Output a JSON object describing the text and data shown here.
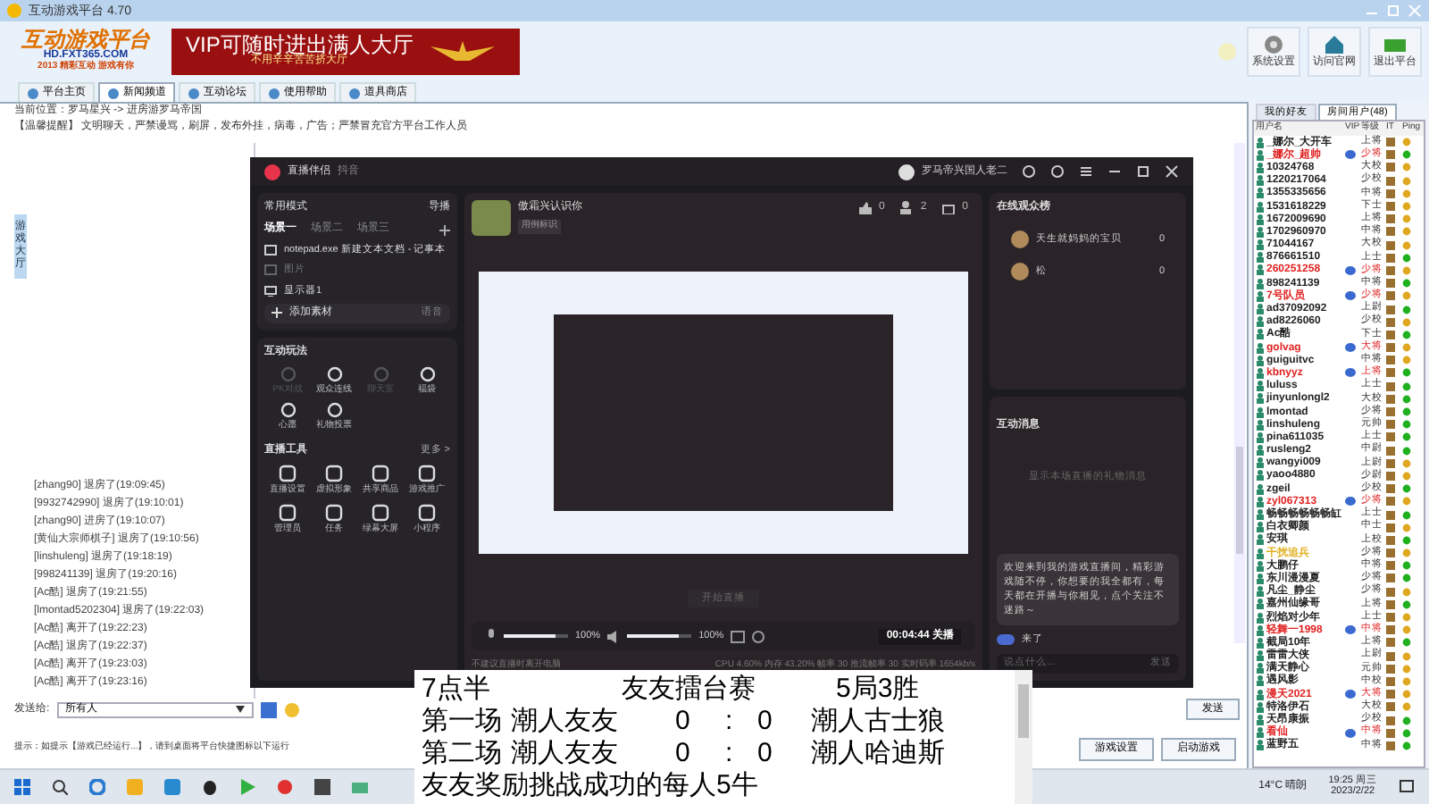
{
  "window": {
    "title": "互动游戏平台 4.70"
  },
  "header": {
    "logo_text": "互动游戏平台",
    "logo_url": "HD.FXT365.COM",
    "logo_slogan": "2013 精彩互动 游戏有你",
    "banner_title": "VIP可随时进出满人大厅",
    "banner_subtitle": "不用辛辛苦苦挤大厅",
    "buttons": [
      {
        "label": "系统设置",
        "kind": "gear"
      },
      {
        "label": "访问官网",
        "kind": "house"
      },
      {
        "label": "退出平台",
        "kind": "exit"
      }
    ]
  },
  "nav_tabs": [
    {
      "label": "平台主页",
      "selected": false
    },
    {
      "label": "新闻频道",
      "selected": true
    },
    {
      "label": "互动论坛",
      "selected": false
    },
    {
      "label": "使用帮助",
      "selected": false
    },
    {
      "label": "道具商店",
      "selected": false
    }
  ],
  "location": "当前位置：罗马星兴 -> 进房游罗马帝国",
  "notice": "【温馨提醒】 文明聊天，严禁谩骂，刷屏，发布外挂，病毒，广告；严禁冒充官方平台工作人员",
  "side_tab": "游戏大厅",
  "chat_log": [
    "[zhang90] 退房了(19:09:45)",
    "[9932742990] 退房了(19:10:01)",
    "[zhang90] 进房了(19:10:07)",
    "[黄仙大宗师棋子] 退房了(19:10:56)",
    "[linshuleng] 退房了(19:18:19)",
    "[998241139] 退房了(19:20:16)",
    "[Ac酷] 退房了(19:21:55)",
    "[lmontad5202304] 退房了(19:22:03)",
    "[Ac酷] 离开了(19:22:23)",
    "[Ac酷] 退房了(19:22:37)",
    "[Ac酷] 离开了(19:23:03)",
    "[Ac酷] 离开了(19:23:16)"
  ],
  "send_to_label": "发送给:",
  "send_to_value": "所有人",
  "send_button": "发送",
  "tip": "提示：如提示【游戏已经运行...】，请到桌面将平台快捷图标以下运行",
  "bottom_buttons": [
    "游戏设置",
    "启动游戏"
  ],
  "user_panel": {
    "tabs": [
      {
        "label": "我的好友",
        "selected": false
      },
      {
        "label": "房间用户(48)",
        "selected": true
      }
    ],
    "columns": [
      "用户名",
      "VIP",
      "等级",
      "IT",
      "Ping"
    ],
    "users": [
      {
        "name": "_娜尔_大开车",
        "level": "上将",
        "color": "#222222",
        "vip": false,
        "ping_good": false
      },
      {
        "name": "_娜尔_超帅",
        "level": "少将",
        "color": "#e02020",
        "vip": true,
        "ping_good": true
      },
      {
        "name": "10324768",
        "level": "大校",
        "color": "#222222",
        "vip": false,
        "ping_good": false
      },
      {
        "name": "1220217064",
        "level": "少校",
        "color": "#222222",
        "vip": false,
        "ping_good": false
      },
      {
        "name": "1355335656",
        "level": "中将",
        "color": "#222222",
        "vip": false,
        "ping_good": false
      },
      {
        "name": "1531618229",
        "level": "下士",
        "color": "#222222",
        "vip": false,
        "ping_good": false
      },
      {
        "name": "1672009690",
        "level": "上将",
        "color": "#222222",
        "vip": false,
        "ping_good": false
      },
      {
        "name": "1702960970",
        "level": "中将",
        "color": "#222222",
        "vip": false,
        "ping_good": false
      },
      {
        "name": "71044167",
        "level": "大校",
        "color": "#222222",
        "vip": false,
        "ping_good": false
      },
      {
        "name": "876661510",
        "level": "上士",
        "color": "#222222",
        "vip": false,
        "ping_good": true
      },
      {
        "name": "260251258",
        "level": "少将",
        "color": "#e02020",
        "vip": true,
        "ping_good": false
      },
      {
        "name": "898241139",
        "level": "中将",
        "color": "#222222",
        "vip": false,
        "ping_good": true
      },
      {
        "name": "7号队员",
        "level": "少将",
        "color": "#e02020",
        "vip": true,
        "ping_good": false
      },
      {
        "name": "ad37092092",
        "level": "上尉",
        "color": "#222222",
        "vip": false,
        "ping_good": true
      },
      {
        "name": "ad8226060",
        "level": "少校",
        "color": "#222222",
        "vip": false,
        "ping_good": false
      },
      {
        "name": "Ac酷",
        "level": "下士",
        "color": "#222222",
        "vip": false,
        "ping_good": true
      },
      {
        "name": "golvag",
        "level": "大将",
        "color": "#e02020",
        "vip": true,
        "ping_good": false
      },
      {
        "name": "guiguitvc",
        "level": "中将",
        "color": "#222222",
        "vip": false,
        "ping_good": false
      },
      {
        "name": "kbnyyz",
        "level": "上将",
        "color": "#e02020",
        "vip": true,
        "ping_good": true
      },
      {
        "name": "luluss",
        "level": "上士",
        "color": "#222222",
        "vip": false,
        "ping_good": true
      },
      {
        "name": "jinyunlongl2",
        "level": "大校",
        "color": "#222222",
        "vip": false,
        "ping_good": true
      },
      {
        "name": "lmontad",
        "level": "少将",
        "color": "#222222",
        "vip": false,
        "ping_good": true
      },
      {
        "name": "linshuleng",
        "level": "元帅",
        "color": "#222222",
        "vip": false,
        "ping_good": true
      },
      {
        "name": "pina611035",
        "level": "上士",
        "color": "#222222",
        "vip": false,
        "ping_good": true
      },
      {
        "name": "rusleng2",
        "level": "中尉",
        "color": "#222222",
        "vip": false,
        "ping_good": true
      },
      {
        "name": "wangyi009",
        "level": "上尉",
        "color": "#222222",
        "vip": false,
        "ping_good": false
      },
      {
        "name": "yaoo4880",
        "level": "少尉",
        "color": "#222222",
        "vip": false,
        "ping_good": false
      },
      {
        "name": "zgeil",
        "level": "少校",
        "color": "#222222",
        "vip": false,
        "ping_good": true
      },
      {
        "name": "zyl067313",
        "level": "少将",
        "color": "#e02020",
        "vip": true,
        "ping_good": false
      },
      {
        "name": "畅畅畅畅畅畅缸",
        "level": "上士",
        "color": "#222222",
        "vip": false,
        "ping_good": true
      },
      {
        "name": "白衣卿颜",
        "level": "中士",
        "color": "#222222",
        "vip": false,
        "ping_good": false
      },
      {
        "name": "安琪",
        "level": "上校",
        "color": "#222222",
        "vip": false,
        "ping_good": true
      },
      {
        "name": "干扰追兵",
        "level": "少将",
        "color": "#e0b020",
        "vip": false,
        "ping_good": false
      },
      {
        "name": "大鹏仔",
        "level": "中将",
        "color": "#222222",
        "vip": false,
        "ping_good": true
      },
      {
        "name": "东川漫漫夏",
        "level": "少将",
        "color": "#222222",
        "vip": false,
        "ping_good": true
      },
      {
        "name": "凡尘_静尘",
        "level": "少将",
        "color": "#222222",
        "vip": false,
        "ping_good": false
      },
      {
        "name": "嘉州仙缘哥",
        "level": "上将",
        "color": "#222222",
        "vip": false,
        "ping_good": true
      },
      {
        "name": "烈焰对少年",
        "level": "上士",
        "color": "#222222",
        "vip": false,
        "ping_good": false
      },
      {
        "name": "轻舞一1998",
        "level": "中将",
        "color": "#e02020",
        "vip": true,
        "ping_good": false
      },
      {
        "name": "截局10年",
        "level": "上将",
        "color": "#222222",
        "vip": false,
        "ping_good": true
      },
      {
        "name": "雷雷大侠",
        "level": "上尉",
        "color": "#222222",
        "vip": false,
        "ping_good": false
      },
      {
        "name": "满天静心",
        "level": "元帅",
        "color": "#222222",
        "vip": false,
        "ping_good": false
      },
      {
        "name": "遇风影",
        "level": "中校",
        "color": "#222222",
        "vip": false,
        "ping_good": false
      },
      {
        "name": "漫天2021",
        "level": "大将",
        "color": "#e02020",
        "vip": true,
        "ping_good": false
      },
      {
        "name": "特洛伊石",
        "level": "大校",
        "color": "#222222",
        "vip": false,
        "ping_good": false
      },
      {
        "name": "天昂康振",
        "level": "少校",
        "color": "#222222",
        "vip": false,
        "ping_good": true
      },
      {
        "name": "看仙",
        "level": "中将",
        "color": "#e02020",
        "vip": true,
        "ping_good": true
      },
      {
        "name": "蓝野五",
        "level": "中将",
        "color": "#222222",
        "vip": false,
        "ping_good": true
      }
    ]
  },
  "stream_app": {
    "title": "直播伴侣",
    "platform": "抖音",
    "account": "罗马帝兴国人老二",
    "mode": "常用模式",
    "director": "导播",
    "scenes": [
      {
        "label": "场景一",
        "selected": true
      },
      {
        "label": "场景二",
        "selected": false
      },
      {
        "label": "场景三",
        "selected": false
      }
    ],
    "sources": [
      {
        "label": "notepad.exe 新建文本文档 - 记事本",
        "kind": "window"
      },
      {
        "label": "图片",
        "kind": "image"
      },
      {
        "label": "显示器1",
        "kind": "monitor"
      }
    ],
    "add_source": "添加素材",
    "add_source_hint": "语音",
    "interact_title": "互动玩法",
    "interact_items": [
      {
        "label": "PK对战",
        "disabled": true
      },
      {
        "label": "观众连线",
        "disabled": false
      },
      {
        "label": "聊天室",
        "disabled": true
      },
      {
        "label": "福袋",
        "disabled": false
      },
      {
        "label": "心愿",
        "disabled": false
      },
      {
        "label": "礼物投票",
        "disabled": false
      }
    ],
    "tools_title": "直播工具",
    "tools_more": "更多 >",
    "tools": [
      "直播设置",
      "虚拟形象",
      "共享商品",
      "游戏推广",
      "管理员",
      "任务",
      "绿幕大屏",
      "小程序"
    ],
    "room_name": "傲霜兴认识你",
    "room_tag": "用例标识",
    "stats": [
      {
        "kind": "like",
        "value": "0"
      },
      {
        "kind": "viewer",
        "value": "2"
      },
      {
        "kind": "gift",
        "value": "0"
      }
    ],
    "mic_volume": {
      "level": 0.8,
      "reading": "100%"
    },
    "speaker_volume": {
      "level": 0.8,
      "reading": "100%"
    },
    "timer": "00:04:44 关播",
    "start_hint": "开始直播",
    "status_left": "不建议直播时离开电脑",
    "status_right": "CPU 4.60%  内存 43.20%  帧率 30  推流帧率 30  实时码率 1654kb/s",
    "viewers_title": "在线观众榜",
    "viewers": [
      {
        "name": "天生就妈妈的宝贝",
        "score": "0"
      },
      {
        "name": "松",
        "score": "0"
      }
    ],
    "messages_title": "互动消息",
    "messages_empty": "显示本场直播的礼物消息",
    "welcome": "欢迎来到我的游戏直播间，精彩游戏随不停，你想要的我全都有，每天都在开播与你相见，点个关注不迷路～",
    "arrival": "来了",
    "chat_placeholder": "说点什么...",
    "chat_send": "发送"
  },
  "scoreboard": {
    "rows": [
      {
        "kind": "header",
        "time": "7点半",
        "event": "友友擂台赛",
        "format": "5局3胜"
      },
      {
        "kind": "match",
        "round": "第一场",
        "home": "潮人友友",
        "home_score": "0",
        "separator": ":",
        "away_score": "0",
        "away": "潮人古士狼"
      },
      {
        "kind": "match",
        "round": "第二场",
        "home": "潮人友友",
        "home_score": "0",
        "separator": ":",
        "away_score": "0",
        "away": "潮人哈迪斯"
      },
      {
        "kind": "note",
        "text": "友友奖励挑战成功的每人5牛"
      }
    ]
  },
  "taskbar": {
    "weather": "14°C 晴朗",
    "time": "19:25 周三",
    "date": "2023/2/22"
  }
}
